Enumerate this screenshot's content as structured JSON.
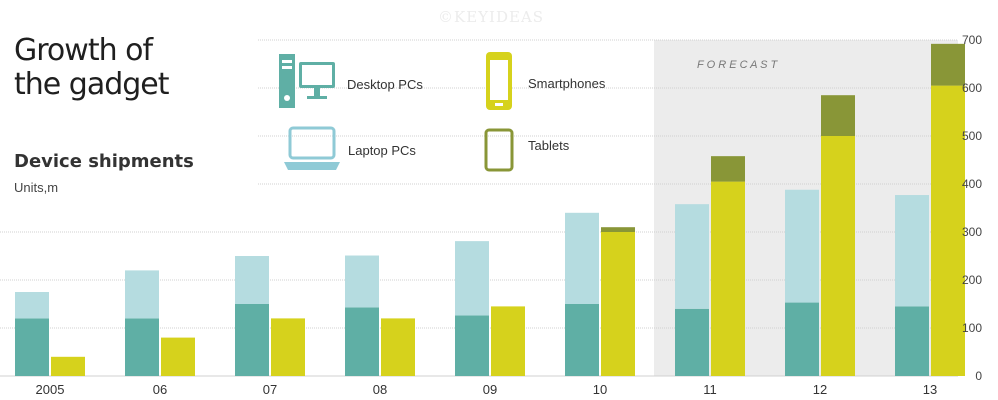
{
  "header": {
    "title_line1": "Growth of",
    "title_line2": "the gadget",
    "subtitle": "Device shipments",
    "units": "Units,m",
    "watermark": "©KEYIDEAS"
  },
  "forecast_label": "F O R E C A S T",
  "colors": {
    "desktop": "#5fafa5",
    "laptop": "#b5dce0",
    "smartphone": "#d6d21c",
    "tablet": "#899637",
    "forecast_bg": "#ececec",
    "grid": "#d0d0d0"
  },
  "legend": [
    {
      "key": "desktop",
      "label": "Desktop PCs",
      "icon": "desktop-pc-icon"
    },
    {
      "key": "smartphone",
      "label": "Smartphones",
      "icon": "smartphone-icon"
    },
    {
      "key": "laptop",
      "label": "Laptop PCs",
      "icon": "laptop-icon"
    },
    {
      "key": "tablet",
      "label": "Tablets",
      "icon": "tablet-icon"
    }
  ],
  "chart_data": {
    "type": "bar",
    "stacked": true,
    "categories": [
      "2005",
      "06",
      "07",
      "08",
      "09",
      "10",
      "11",
      "12",
      "13"
    ],
    "forecast_from_index": 6,
    "ylim": [
      0,
      700
    ],
    "yticks": [
      0,
      100,
      200,
      300,
      400,
      500,
      600,
      700
    ],
    "y_axis_side": "right",
    "grid": true,
    "series": [
      {
        "name": "Desktop PCs",
        "key": "desktop",
        "group": "pc",
        "values": [
          120,
          120,
          150,
          143,
          126,
          150,
          140,
          153,
          145
        ]
      },
      {
        "name": "Laptop PCs",
        "key": "laptop",
        "group": "pc",
        "values": [
          55,
          100,
          100,
          108,
          155,
          190,
          218,
          235,
          232
        ]
      },
      {
        "name": "Smartphones",
        "key": "smartphone",
        "group": "mobile",
        "values": [
          40,
          80,
          120,
          120,
          145,
          300,
          405,
          500,
          605
        ]
      },
      {
        "name": "Tablets",
        "key": "tablet",
        "group": "mobile",
        "values": [
          0,
          0,
          0,
          0,
          0,
          10,
          53,
          85,
          87
        ]
      }
    ]
  }
}
